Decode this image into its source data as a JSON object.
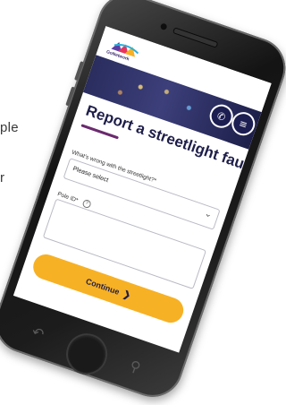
{
  "side_text": {
    "line1": "ple",
    "line2": "r"
  },
  "screen": {
    "brand": {
      "name": "GoNetwork",
      "logo_colors": [
        "#5b3ea6",
        "#e8345c",
        "#f7b124",
        "#2bb0d8"
      ]
    },
    "header": {
      "phone_button_icon": "phone-icon",
      "menu_button_icon": "menu-icon"
    },
    "page_title": "Report a streetlight fault",
    "form": {
      "issue_label": "What's wrong with the streetlight?*",
      "issue_value": "Please select",
      "pole_label": "Pole ID*",
      "pole_value": ""
    },
    "continue_label": "Continue"
  },
  "colors": {
    "accent_yellow": "#f7b124",
    "navy": "#1e1e4a",
    "underline": "#6b2a6e"
  }
}
